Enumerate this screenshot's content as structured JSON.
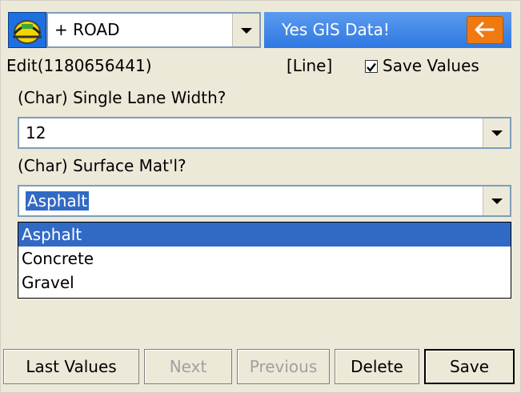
{
  "header": {
    "feature_value": "+ ROAD",
    "gis_banner": "Yes GIS Data!",
    "colors": {
      "banner": "#2f78e0",
      "back_button": "#f07a10"
    }
  },
  "info": {
    "edit_id": "Edit(1180656441)",
    "geometry": "[Line]",
    "save_values_label": "Save Values",
    "save_values_checked": true
  },
  "fields": [
    {
      "label": "(Char) Single Lane Width?",
      "value": "12"
    },
    {
      "label": "(Char) Surface Mat'l?",
      "value": "Asphalt"
    }
  ],
  "dropdown_options": [
    "Asphalt",
    "Concrete",
    "Gravel"
  ],
  "buttons": {
    "last_values": "Last Values",
    "next": "Next",
    "previous": "Previous",
    "delete": "Delete",
    "save": "Save"
  }
}
